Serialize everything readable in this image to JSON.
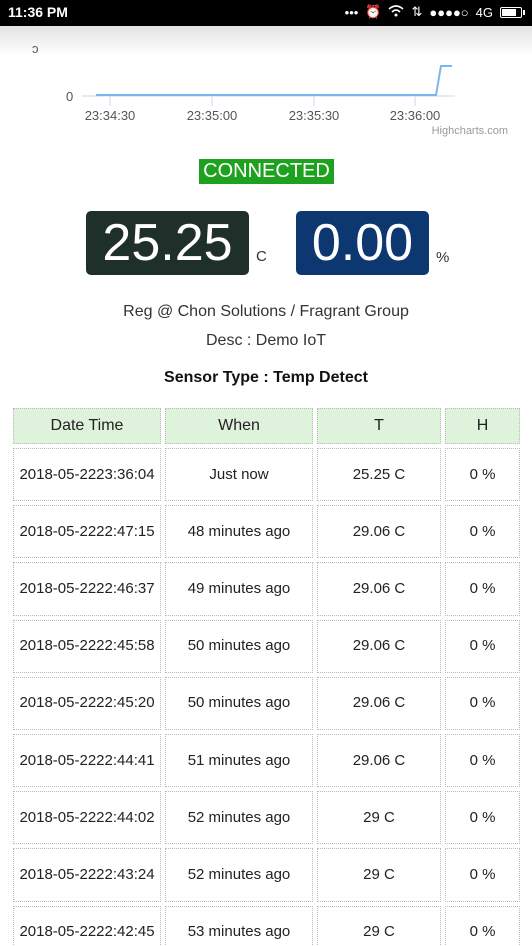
{
  "statusbar": {
    "time": "11:36 PM",
    "network": "4G"
  },
  "chart": {
    "y_tick": "0",
    "x_ticks": [
      "23:34:30",
      "23:35:00",
      "23:35:30",
      "23:36:00"
    ],
    "credits": "Highcharts.com"
  },
  "chart_data": {
    "type": "line",
    "x": [
      "23:34:30",
      "23:35:00",
      "23:35:30",
      "23:36:00"
    ],
    "series": [
      {
        "values": [
          0,
          0,
          0,
          0,
          25.25
        ]
      }
    ],
    "ylim_label": "0"
  },
  "status": {
    "label": "CONNECTED",
    "color": "#1ea11e"
  },
  "readings": {
    "temperature": "25.25",
    "temperature_unit": "C",
    "humidity": "0.00",
    "humidity_unit": "%"
  },
  "info": {
    "reg": "Reg @ Chon Solutions / Fragrant Group",
    "desc": "Desc : Demo IoT",
    "sensor_type": "Sensor Type : Temp Detect"
  },
  "table": {
    "headers": [
      "Date Time",
      "When",
      "T",
      "H"
    ],
    "rows": [
      {
        "date": "2018-05-22",
        "time": "23:36:04",
        "when": "Just now",
        "t": "25.25 C",
        "h": "0 %"
      },
      {
        "date": "2018-05-22",
        "time": "22:47:15",
        "when": "48 minutes ago",
        "t": "29.06 C",
        "h": "0 %"
      },
      {
        "date": "2018-05-22",
        "time": "22:46:37",
        "when": "49 minutes ago",
        "t": "29.06 C",
        "h": "0 %"
      },
      {
        "date": "2018-05-22",
        "time": "22:45:58",
        "when": "50 minutes ago",
        "t": "29.06 C",
        "h": "0 %"
      },
      {
        "date": "2018-05-22",
        "time": "22:45:20",
        "when": "50 minutes ago",
        "t": "29.06 C",
        "h": "0 %"
      },
      {
        "date": "2018-05-22",
        "time": "22:44:41",
        "when": "51 minutes ago",
        "t": "29.06 C",
        "h": "0 %"
      },
      {
        "date": "2018-05-22",
        "time": "22:44:02",
        "when": "52 minutes ago",
        "t": "29 C",
        "h": "0 %"
      },
      {
        "date": "2018-05-22",
        "time": "22:43:24",
        "when": "52 minutes ago",
        "t": "29 C",
        "h": "0 %"
      },
      {
        "date": "2018-05-22",
        "time": "22:42:45",
        "when": "53 minutes ago",
        "t": "29 C",
        "h": "0 %"
      }
    ]
  }
}
